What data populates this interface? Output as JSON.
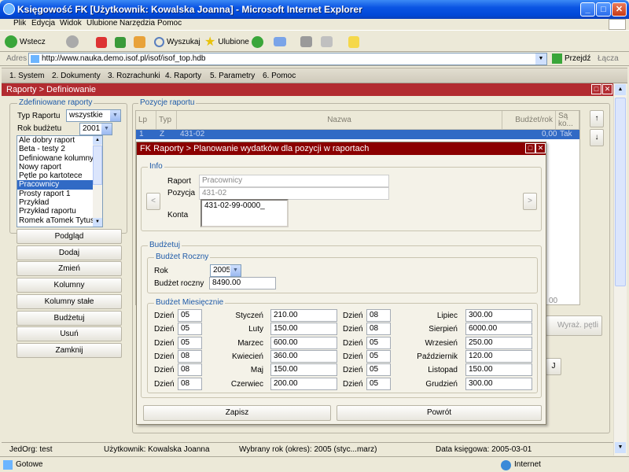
{
  "window": {
    "title": "Księgowość FK [Użytkownik: Kowalska Joanna] - Microsoft Internet Explorer"
  },
  "ie_menu": [
    "Plik",
    "Edycja",
    "Widok",
    "Ulubione",
    "Narzędzia",
    "Pomoc"
  ],
  "ie_toolbar": {
    "back": "Wstecz",
    "search": "Wyszukaj",
    "favorites": "Ulubione"
  },
  "address": {
    "label": "Adres",
    "url": "http://www.nauka.demo.isof.pl/isof/isof_top.hdb",
    "go": "Przejdź",
    "links": "Łącza"
  },
  "app_menu": [
    "1. System",
    "2. Dokumenty",
    "3. Rozrachunki",
    "4. Raporty",
    "5. Parametry",
    "6. Pomoc"
  ],
  "inner_title": "Raporty > Definiowanie",
  "left": {
    "group_label": "Zdefiniowane raporty",
    "type_label": "Typ Raportu",
    "type_value": "wszystkie",
    "year_label": "Rok budżetu",
    "year_value": "2001",
    "reports": [
      "Ale dobry raport",
      "Beta - testy 2",
      "Definiowane kolumny",
      "Nowy raport",
      "Pętle po kartotece",
      "Pracownicy",
      "Prosty raport 1",
      "Przykład",
      "Przykład raportu",
      "Romek aTomek Tytus"
    ],
    "selected_report": "Pracownicy",
    "buttons": [
      "Podgląd",
      "Dodaj",
      "Zmień",
      "Kolumny",
      "Kolumny stałe",
      "Budżetuj",
      "Usuń",
      "Zamknij"
    ]
  },
  "positions": {
    "group_label": "Pozycje raportu",
    "headers": {
      "lp": "Lp",
      "typ": "Typ",
      "nazwa": "Nazwa",
      "budzet": "Budżet/rok",
      "sa": "Są ko..."
    },
    "row": {
      "lp": "1",
      "typ": "Z",
      "nazwa": "431-02",
      "budzet": "0,00",
      "sa": "Tak"
    },
    "total": "00",
    "loop_button": "Wyraż. pętli",
    "small_button": "J"
  },
  "dialog": {
    "title": "FK Raporty > Planowanie wydatków dla pozycji w raportach",
    "info_label": "Info",
    "raport_label": "Raport",
    "raport_value": "Pracownicy",
    "pozycja_label": "Pozycja",
    "pozycja_value": "431-02",
    "konta_label": "Konta",
    "konta_value": "431-02-99-0000_",
    "prev": "<",
    "next": ">",
    "budzetuj_label": "Budżetuj",
    "roczny_label": "Budżet Roczny",
    "rok_label": "Rok",
    "rok_value": "2005",
    "budzet_roczny_label": "Budżet roczny",
    "budzet_roczny_value": "8490.00",
    "miesieczny_label": "Budżet Miesięcznie",
    "day_label": "Dzień",
    "months": [
      {
        "name": "Styczeń",
        "day": "05",
        "amount": "210.00"
      },
      {
        "name": "Luty",
        "day": "05",
        "amount": "150.00"
      },
      {
        "name": "Marzec",
        "day": "05",
        "amount": "600.00"
      },
      {
        "name": "Kwiecień",
        "day": "08",
        "amount": "360.00"
      },
      {
        "name": "Maj",
        "day": "08",
        "amount": "150.00"
      },
      {
        "name": "Czerwiec",
        "day": "08",
        "amount": "200.00"
      },
      {
        "name": "Lipiec",
        "day": "08",
        "amount": "300.00"
      },
      {
        "name": "Sierpień",
        "day": "08",
        "amount": "6000.00"
      },
      {
        "name": "Wrzesień",
        "day": "05",
        "amount": "250.00"
      },
      {
        "name": "Październik",
        "day": "05",
        "amount": "120.00"
      },
      {
        "name": "Listopad",
        "day": "05",
        "amount": "150.00"
      },
      {
        "name": "Grudzień",
        "day": "05",
        "amount": "300.00"
      }
    ],
    "save": "Zapisz",
    "back": "Powrót"
  },
  "status": {
    "jedorg": "JedOrg:  test",
    "user": "Użytkownik:  Kowalska Joanna",
    "year": "Wybrany rok (okres):  2005 (styc...marz)",
    "date": "Data księgowa:  2005-03-01"
  },
  "ie_status": {
    "left": "Gotowe",
    "zone": "Internet"
  },
  "colors": {
    "title_blue": "#0a54e3",
    "inner_red": "#b22b30",
    "dialog_red": "#8b0000",
    "selection": "#316ac5",
    "label_blue": "#1e5aa8"
  }
}
